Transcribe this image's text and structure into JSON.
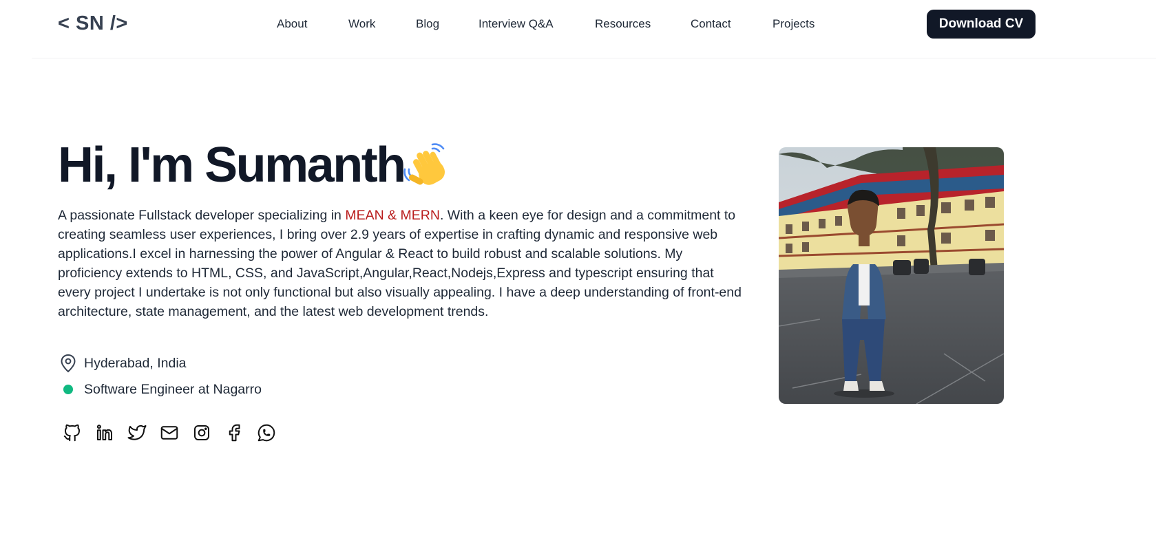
{
  "header": {
    "logo": "< SN />",
    "nav": [
      "About",
      "Work",
      "Blog",
      "Interview Q&A",
      "Resources",
      "Contact",
      "Projects"
    ],
    "cv_button": "Download CV"
  },
  "hero": {
    "greeting": "Hi, I'm Sumanth",
    "bio_before": "A passionate Fullstack developer specializing in ",
    "bio_highlight": "MEAN & MERN",
    "bio_after": ". With a keen eye for design and a commitment to creating seamless user experiences, I bring over 2.9 years of expertise in crafting dynamic and responsive web applications.I excel in harnessing the power of Angular & React to build robust and scalable solutions. My proficiency extends to HTML, CSS, and JavaScript,Angular,React,Nodejs,Express and typescript ensuring that every project I undertake is not only functional but also visually appealing. I have a deep understanding of front-end architecture, state management, and the latest web development trends.",
    "location": "Hyderabad, India",
    "job": "Software Engineer at Nagarro",
    "socials": [
      "github-icon",
      "linkedin-icon",
      "twitter-icon",
      "mail-icon",
      "instagram-icon",
      "facebook-icon",
      "whatsapp-icon"
    ]
  },
  "colors": {
    "accent": "#b91c1c",
    "status_dot": "#10b981",
    "button_bg": "#111827"
  }
}
